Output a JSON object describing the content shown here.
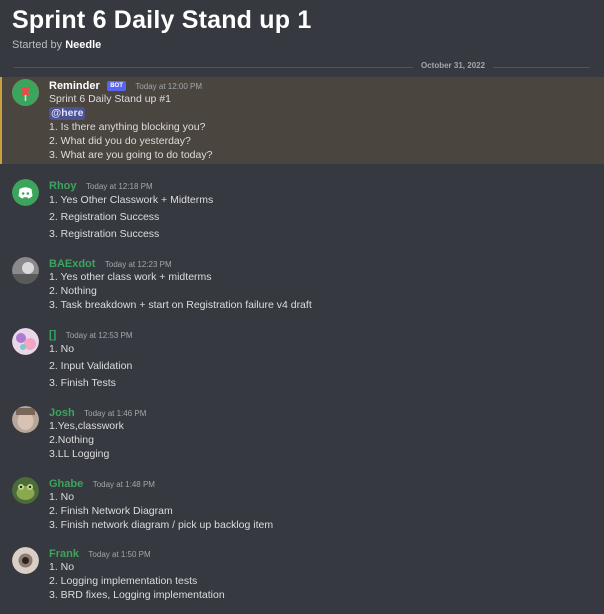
{
  "thread": {
    "title": "Sprint 6 Daily Stand up 1",
    "started_by_prefix": "Started by",
    "started_by": "Needle",
    "date_divider": "October 31, 2022"
  },
  "colors": {
    "background": "#36393f",
    "highlight_bg": "#4b4540",
    "highlight_border": "#c8a03e",
    "author_green": "#3ba55d",
    "author_white": "#ffffff",
    "mention_bg": "#4c5392"
  },
  "messages": [
    {
      "author": "Reminder",
      "bot_tag": "BOT",
      "time": "Today at 12:00 PM",
      "lines": [
        "Sprint 6 Daily Stand up #1",
        "@here",
        "1. Is there anything blocking you?",
        "2. What did you do yesterday?",
        "3. What are you going to do today?"
      ],
      "avatar_icon": "pushpin-avatar"
    },
    {
      "author": "Rhoy",
      "time": "Today at 12:18 PM",
      "lines": [
        "1. Yes Other Classwork + Midterms",
        "2. Registration Success",
        "3. Registration Success"
      ],
      "avatar_icon": "discord-logo-avatar"
    },
    {
      "author": "BAExdot",
      "time": "Today at 12:23 PM",
      "lines": [
        "1. Yes other class work + midterms",
        "2. Nothing",
        "3. Task breakdown + start on Registration failure v4 draft"
      ],
      "avatar_icon": "photo-avatar"
    },
    {
      "author": "[]",
      "time": "Today at 12:53 PM",
      "lines": [
        "1. No",
        "2. Input Validation",
        "3. Finish Tests"
      ],
      "avatar_icon": "illustration-avatar"
    },
    {
      "author": "Josh",
      "time": "Today at 1:46 PM",
      "lines": [
        "1.Yes,classwork",
        "2.Nothing",
        "3.LL Logging"
      ],
      "avatar_icon": "photo-avatar"
    },
    {
      "author": "Ghabe",
      "time": "Today at 1:48 PM",
      "lines": [
        "1. No",
        "2. Finish Network Diagram",
        "3. Finish network diagram / pick up backlog item"
      ],
      "avatar_icon": "frog-avatar"
    },
    {
      "author": "Frank",
      "time": "Today at 1:50 PM",
      "lines": [
        "1. No",
        "2. Logging implementation tests",
        "3. BRD fixes, Logging implementation"
      ],
      "avatar_icon": "eye-avatar"
    }
  ]
}
